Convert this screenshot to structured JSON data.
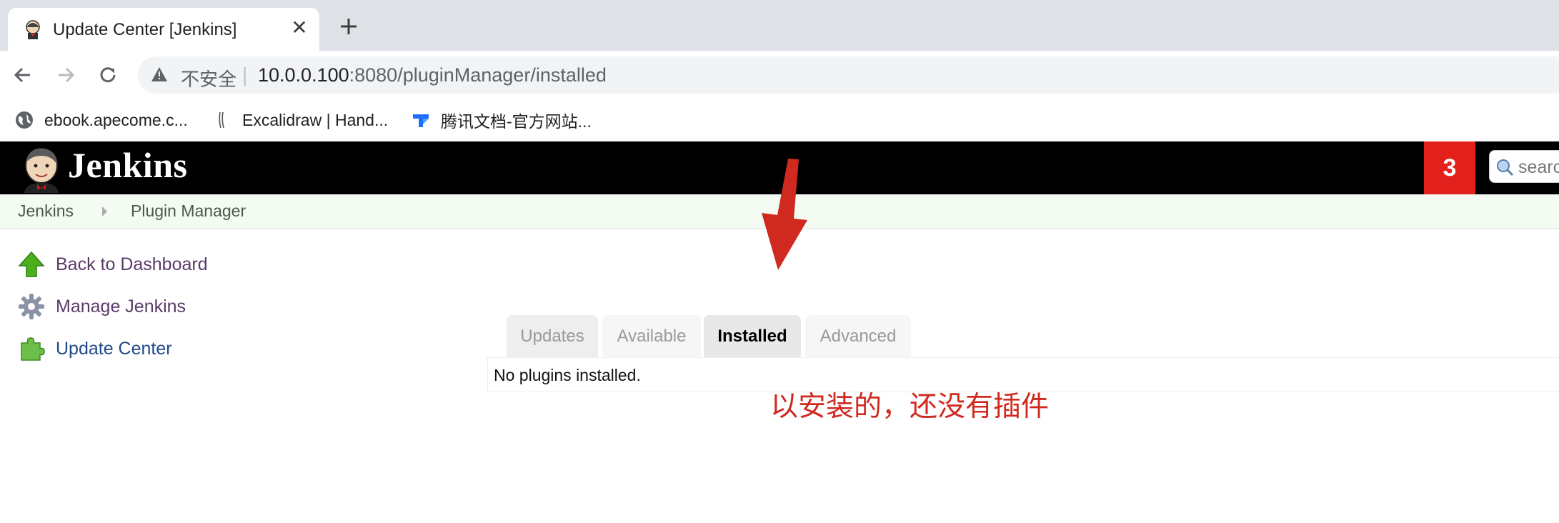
{
  "browser": {
    "tab_title": "Update Center [Jenkins]",
    "close_glyph": "✕",
    "not_secure_label": "不安全",
    "separator": "|",
    "url_host": "10.0.0.100",
    "url_rest": ":8080/pluginManager/installed",
    "bookmarks": [
      {
        "label": "ebook.apecome.c...",
        "icon": "globe-icon"
      },
      {
        "label": "Excalidraw | Hand...",
        "icon": "excalidraw-icon"
      },
      {
        "label": "腾讯文档-官方网站...",
        "icon": "tencent-docs-icon"
      }
    ]
  },
  "jenkins": {
    "logo_text": "Jenkins",
    "notification_count": "3",
    "search_placeholder": "search",
    "breadcrumb": [
      "Jenkins",
      "Plugin Manager"
    ],
    "sidebar": [
      {
        "label": "Back to Dashboard",
        "icon": "up-arrow-icon"
      },
      {
        "label": "Manage Jenkins",
        "icon": "gear-icon"
      },
      {
        "label": "Update Center",
        "icon": "puzzle-piece-icon"
      }
    ],
    "tabs": [
      "Updates",
      "Available",
      "Installed",
      "Advanced"
    ],
    "active_tab": "Installed",
    "empty_message": "No plugins installed."
  },
  "annotation": {
    "text": "以安装的，还没有插件",
    "color": "#d0291f"
  },
  "colors": {
    "header_bg": "#000000",
    "notification_bg": "#e2211c",
    "breadcrumb_bg": "#f4fbf2",
    "chrome_tabstrip": "#dee1e6"
  }
}
